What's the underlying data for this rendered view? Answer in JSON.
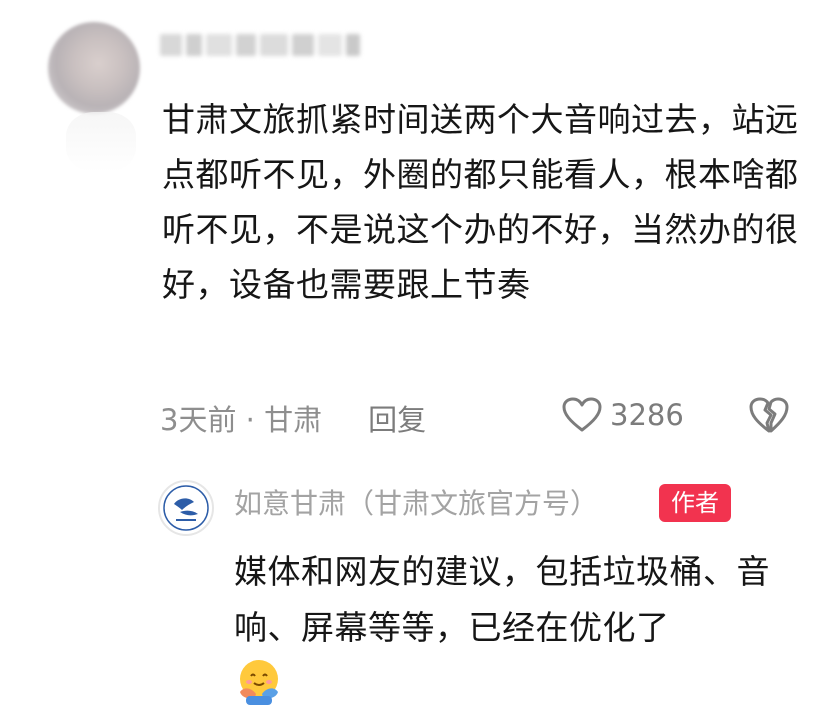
{
  "comment": {
    "text": "甘肃文旅抓紧时间送两个大音响过去，站远点都听不见，外圈的都只能看人，根本啥都听不见，不是说这个办的不好，当然办的很好，设备也需要跟上节奏",
    "time_location": "3天前 · 甘肃",
    "reply_label": "回复",
    "like_count": "3286",
    "icons": {
      "like": "heart-outline-icon",
      "dislike": "broken-heart-icon"
    }
  },
  "reply": {
    "author_name": "如意甘肃（甘肃文旅官方号）",
    "badge": "作者",
    "text": "媒体和网友的建议，包括垃圾桶、音响、屏幕等等，已经在优化了",
    "emoji": "hugging-face-emoji"
  },
  "colors": {
    "badge": "#f2334f",
    "text": "#161616",
    "muted": "#8e8e8e"
  }
}
